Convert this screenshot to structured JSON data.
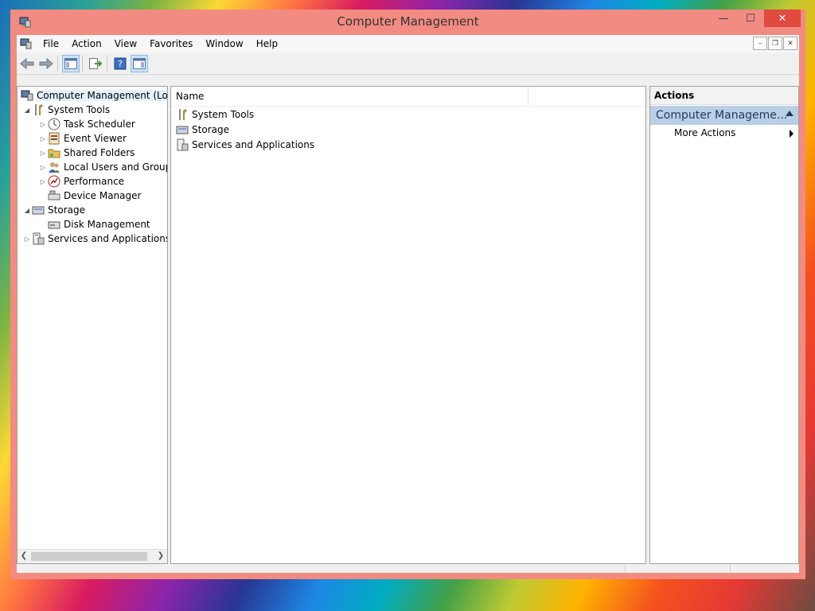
{
  "window": {
    "title": "Computer Management",
    "minimize": "—",
    "maximize": "☐",
    "close": "✕"
  },
  "menu": {
    "items": [
      "File",
      "Action",
      "View",
      "Favorites",
      "Window",
      "Help"
    ]
  },
  "mdi": {
    "min": "–",
    "restore": "❐",
    "close": "✕"
  },
  "tree": {
    "root": "Computer Management (Local",
    "items": [
      {
        "label": "System Tools",
        "icon": "tools-icon"
      },
      {
        "label": "Task Scheduler",
        "icon": "clock-icon"
      },
      {
        "label": "Event Viewer",
        "icon": "event-viewer-icon"
      },
      {
        "label": "Shared Folders",
        "icon": "shared-folder-icon"
      },
      {
        "label": "Local Users and Groups",
        "icon": "users-icon"
      },
      {
        "label": "Performance",
        "icon": "performance-icon"
      },
      {
        "label": "Device Manager",
        "icon": "device-manager-icon"
      },
      {
        "label": "Storage",
        "icon": "storage-icon"
      },
      {
        "label": "Disk Management",
        "icon": "disk-icon"
      },
      {
        "label": "Services and Applications",
        "icon": "services-icon"
      }
    ]
  },
  "list": {
    "column_name": "Name",
    "rows": [
      "System Tools",
      "Storage",
      "Services and Applications"
    ]
  },
  "actions": {
    "header": "Actions",
    "section": "Computer Manageme...",
    "item": "More Actions"
  }
}
